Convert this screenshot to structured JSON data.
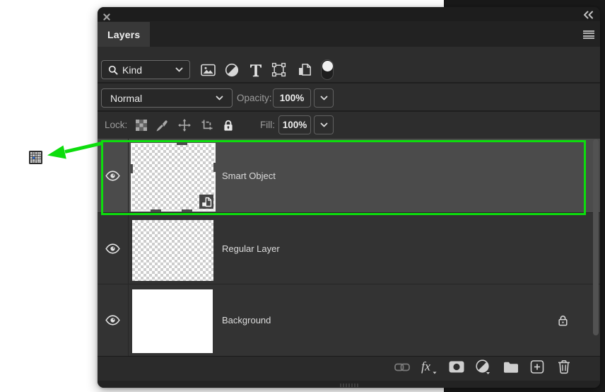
{
  "colors": {
    "accent_green": "#0ddd0d",
    "pixel_blue": "#2e78f0",
    "panel_bg": "#2d2d2d",
    "selected_row_bg": "#4b4b4b",
    "dock_bg": "#191919"
  },
  "panel": {
    "title": "Layers",
    "window_controls": {
      "close_icon": "x",
      "collapse_icon": "double-chevron-left",
      "menu_icon": "hamburger-menu"
    },
    "filter_row": {
      "search_label": "Kind",
      "search_icon": "magnifier",
      "type_filters": [
        "image-filter",
        "adjustment-filter",
        "type-filter",
        "shape-filter",
        "smart-object-filter"
      ],
      "toggle": "filtering-on-off-switch"
    },
    "blend_row": {
      "blend_mode": "Normal",
      "opacity_label": "Opacity:",
      "opacity_value": "100%"
    },
    "lock_row": {
      "label": "Lock:",
      "lock_icons": [
        "lock-transparent-pixels",
        "lock-image-pixels",
        "lock-position",
        "lock-artboard",
        "lock-all"
      ],
      "fill_label": "Fill:",
      "fill_value": "100%"
    },
    "layers": [
      {
        "name": "Smart Object",
        "visible": true,
        "selected": true,
        "thumbnail": "transparent-checkerboard",
        "badge": "smart-object-badge",
        "locked": false
      },
      {
        "name": "Regular Layer",
        "visible": true,
        "selected": false,
        "thumbnail": "transparent-checkerboard",
        "badge": null,
        "locked": false
      },
      {
        "name": "Background",
        "visible": true,
        "selected": false,
        "thumbnail": "white",
        "badge": null,
        "locked": true
      }
    ],
    "footer_icons": [
      "link-layers",
      "layer-style-fx",
      "add-layer-mask",
      "new-adjustment-layer",
      "new-group",
      "new-layer",
      "delete-layer"
    ]
  },
  "annotation": {
    "highlighted_layer": "Smart Object",
    "arrow_points_to": "pixel-grid-icon",
    "color": "#0ddd0d"
  }
}
